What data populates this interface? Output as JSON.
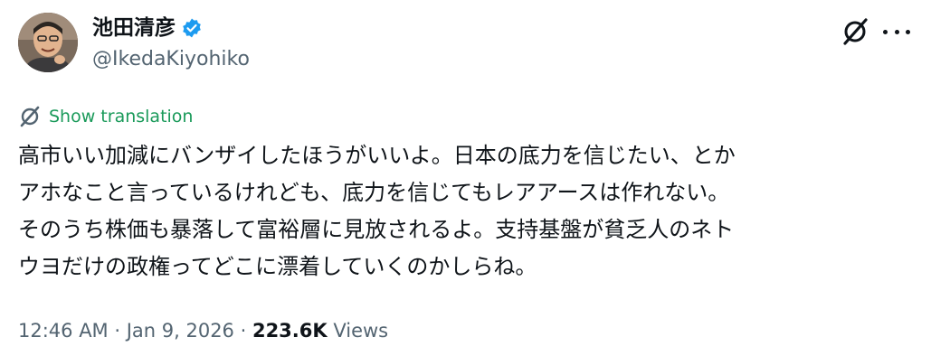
{
  "author": {
    "name": "池田清彦",
    "handle": "@IkedaKiyohiko",
    "verified": true
  },
  "translation": {
    "label": "Show translation"
  },
  "tweet": {
    "text": "高市いい加減にバンザイしたほうがいいよ。日本の底力を信じたい、とか\nアホなこと言っているけれども、底力を信じてもレアアースは作れない。\nそのうち株価も暴落して富裕層に見放されるよ。支持基盤が貧乏人のネト\nウヨだけの政権ってどこに漂着していくのかしらね。"
  },
  "meta": {
    "time": "12:46 AM",
    "separator1": " · ",
    "date": "Jan 9, 2026",
    "separator2": " · ",
    "views_count": "223.6K",
    "views_label": " Views"
  },
  "icons": {
    "verified": "verified-badge-icon",
    "grok": "grok-icon",
    "more": "more-icon",
    "translate": "translate-icon"
  },
  "colors": {
    "verified_blue": "#1d9bf0",
    "translate_green": "#1a9a5a",
    "secondary_text": "#536471",
    "primary_text": "#0f1419"
  }
}
